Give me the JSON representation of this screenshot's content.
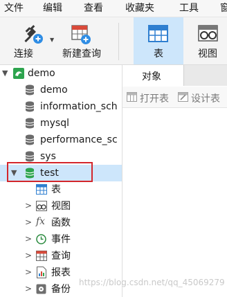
{
  "menubar": {
    "items": [
      "文件",
      "编辑",
      "查看",
      "收藏夹",
      "工具",
      "窗"
    ]
  },
  "toolbar": {
    "connect": "连接",
    "new_query": "新建查询",
    "table": "表",
    "view": "视图"
  },
  "tree": {
    "connection": "demo",
    "databases": [
      "demo",
      "information_sch",
      "mysql",
      "performance_sc",
      "sys",
      "test"
    ],
    "test_children": [
      "表",
      "视图",
      "函数",
      "事件",
      "查询",
      "报表",
      "备份"
    ],
    "func_glyph": "fx"
  },
  "right": {
    "tab": "对象",
    "open_table": "打开表",
    "design_table": "设计表"
  },
  "watermark": "https://blog.csdn.net/qq_45069279",
  "colors": {
    "selection": "#cde6fb",
    "highlight_box": "#d3262b",
    "db_green": "#2da44e"
  }
}
